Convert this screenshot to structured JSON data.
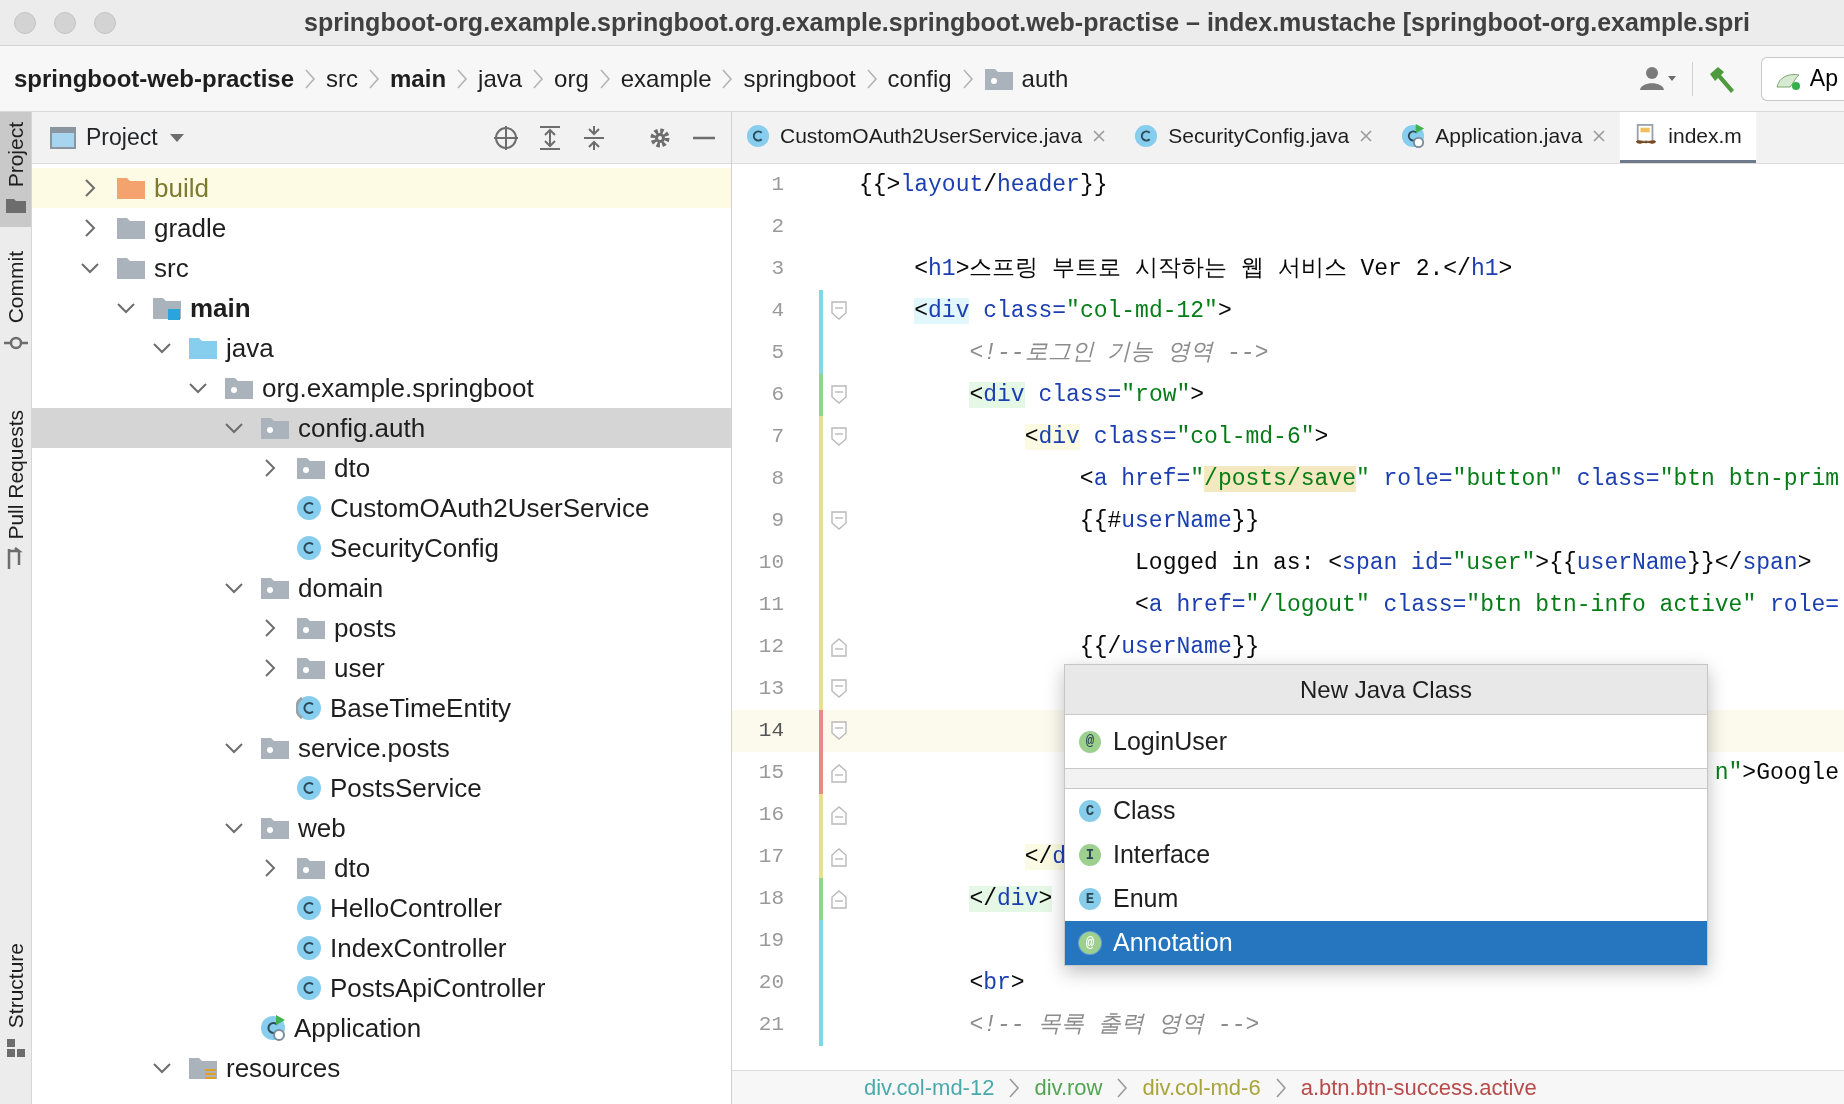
{
  "window": {
    "title": "springboot-org.example.springboot.org.example.springboot.web-practise – index.mustache [springboot-org.example.spri"
  },
  "breadcrumbs": [
    {
      "text": "springboot-web-practise",
      "bold": true,
      "kind": "plain"
    },
    {
      "text": "src",
      "bold": false,
      "kind": "plain"
    },
    {
      "text": "main",
      "bold": true,
      "kind": "plain"
    },
    {
      "text": "java",
      "bold": false,
      "kind": "plain"
    },
    {
      "text": "org",
      "bold": false,
      "kind": "plain"
    },
    {
      "text": "example",
      "bold": false,
      "kind": "plain"
    },
    {
      "text": "springboot",
      "bold": false,
      "kind": "plain"
    },
    {
      "text": "config",
      "bold": false,
      "kind": "plain"
    },
    {
      "text": "auth",
      "bold": false,
      "kind": "package"
    }
  ],
  "toolbar": {
    "run_config": "Ap"
  },
  "tool_strip": [
    {
      "label": "Project",
      "kind": "project",
      "selected": true
    },
    {
      "label": "Commit",
      "kind": "commit",
      "selected": false
    },
    {
      "label": "Pull Requests",
      "kind": "pull-requests",
      "selected": false
    },
    {
      "label": "Structure",
      "kind": "structure",
      "selected": false
    }
  ],
  "project": {
    "title": "Project",
    "tree": [
      {
        "label": "build",
        "kind": "excluded",
        "expanded": false,
        "selected": false
      },
      {
        "label": "gradle",
        "kind": "folder",
        "expanded": false,
        "selected": false
      },
      {
        "label": "src",
        "kind": "folder",
        "expanded": true,
        "selected": false,
        "children": [
          {
            "label": "main",
            "kind": "source-root",
            "expanded": true,
            "selected": false,
            "children": [
              {
                "label": "java",
                "kind": "java-root",
                "expanded": true,
                "selected": false,
                "children": [
                  {
                    "label": "org.example.springboot",
                    "kind": "package",
                    "expanded": true,
                    "selected": false,
                    "children": [
                      {
                        "label": "config.auth",
                        "kind": "package",
                        "expanded": true,
                        "selected": true,
                        "children": [
                          {
                            "label": "dto",
                            "kind": "package",
                            "expanded": false,
                            "selected": false
                          },
                          {
                            "label": "CustomOAuth2UserService",
                            "kind": "class",
                            "selected": false
                          },
                          {
                            "label": "SecurityConfig",
                            "kind": "class",
                            "selected": false
                          }
                        ]
                      },
                      {
                        "label": "domain",
                        "kind": "package",
                        "expanded": true,
                        "selected": false,
                        "children": [
                          {
                            "label": "posts",
                            "kind": "package",
                            "expanded": false,
                            "selected": false
                          },
                          {
                            "label": "user",
                            "kind": "package",
                            "expanded": false,
                            "selected": false
                          },
                          {
                            "label": "BaseTimeEntity",
                            "kind": "abstract-class",
                            "selected": false
                          }
                        ]
                      },
                      {
                        "label": "service.posts",
                        "kind": "package",
                        "expanded": true,
                        "selected": false,
                        "children": [
                          {
                            "label": "PostsService",
                            "kind": "class",
                            "selected": false
                          }
                        ]
                      },
                      {
                        "label": "web",
                        "kind": "package",
                        "expanded": true,
                        "selected": false,
                        "children": [
                          {
                            "label": "dto",
                            "kind": "package",
                            "expanded": false,
                            "selected": false
                          },
                          {
                            "label": "HelloController",
                            "kind": "class",
                            "selected": false
                          },
                          {
                            "label": "IndexController",
                            "kind": "class",
                            "selected": false
                          },
                          {
                            "label": "PostsApiController",
                            "kind": "class",
                            "selected": false
                          }
                        ]
                      },
                      {
                        "label": "Application",
                        "kind": "application",
                        "selected": false
                      }
                    ]
                  }
                ]
              },
              {
                "label": "resources",
                "kind": "resources-root",
                "expanded": true,
                "selected": false
              }
            ]
          }
        ]
      }
    ]
  },
  "tabs": [
    {
      "label": "CustomOAuth2UserService.java",
      "kind": "class",
      "selected": false,
      "closable": true
    },
    {
      "label": "SecurityConfig.java",
      "kind": "class",
      "selected": false,
      "closable": true
    },
    {
      "label": "Application.java",
      "kind": "application",
      "selected": false,
      "closable": true
    },
    {
      "label": "index.m",
      "kind": "mustache",
      "selected": true,
      "closable": false
    }
  ],
  "editor": {
    "lines": [
      {
        "number": "1",
        "kind": "plain",
        "current": false,
        "tokens": [
          {
            "kind": "text",
            "text": "{{>"
          },
          {
            "kind": "mustache",
            "text": "layout"
          },
          {
            "kind": "text",
            "text": "/"
          },
          {
            "kind": "mustache",
            "text": "header"
          },
          {
            "kind": "text",
            "text": "}}"
          }
        ]
      },
      {
        "number": "2",
        "kind": "plain",
        "current": false
      },
      {
        "number": "3",
        "kind": "plain",
        "current": false,
        "tokens": [
          {
            "kind": "text",
            "text": "    <"
          },
          {
            "kind": "tag",
            "text": "h1"
          },
          {
            "kind": "text",
            "text": ">스프링 부트로 시작하는 웹 서비스 Ver 2.</"
          },
          {
            "kind": "tag",
            "text": "h1"
          },
          {
            "kind": "text",
            "text": ">"
          }
        ]
      },
      {
        "number": "4",
        "kind": "fold-start",
        "current": false,
        "color": "#80d8e2",
        "tokens": [
          {
            "kind": "text",
            "text": "    <",
            "color": "#e2f7fb"
          },
          {
            "kind": "tag",
            "text": "div",
            "color": "#e2f7fb"
          },
          {
            "kind": "attr",
            "text": " class="
          },
          {
            "kind": "string",
            "text": "\"col-md-12\""
          },
          {
            "kind": "text",
            "text": ">"
          }
        ]
      },
      {
        "number": "5",
        "kind": "plain",
        "current": false,
        "color": "#80d8e2",
        "tokens": [
          {
            "kind": "comment",
            "text": "        <!--로그인 기능 영역 -->"
          }
        ]
      },
      {
        "number": "6",
        "kind": "fold-start",
        "current": false,
        "color": "#8fd48f",
        "tokens": [
          {
            "kind": "text",
            "text": "        <",
            "color": "#e5f8e5"
          },
          {
            "kind": "tag",
            "text": "div",
            "color": "#e5f8e5"
          },
          {
            "kind": "attr",
            "text": " class="
          },
          {
            "kind": "string",
            "text": "\"row\""
          },
          {
            "kind": "text",
            "text": ">"
          }
        ]
      },
      {
        "number": "7",
        "kind": "fold-start",
        "current": false,
        "color": "#e4e08f",
        "tokens": [
          {
            "kind": "text",
            "text": "            <",
            "color": "#fbfbe3"
          },
          {
            "kind": "tag",
            "text": "div",
            "color": "#fbfbe3"
          },
          {
            "kind": "attr",
            "text": " class="
          },
          {
            "kind": "string",
            "text": "\"col-md-6\""
          },
          {
            "kind": "text",
            "text": ">"
          }
        ]
      },
      {
        "number": "8",
        "kind": "plain",
        "current": false,
        "color": "#e4e08f",
        "tokens": [
          {
            "kind": "text",
            "text": "                <"
          },
          {
            "kind": "tag",
            "text": "a"
          },
          {
            "kind": "attr",
            "text": " href="
          },
          {
            "kind": "string",
            "text": "\""
          },
          {
            "kind": "string",
            "text": "/posts/save",
            "color": "#f4e8c0"
          },
          {
            "kind": "string",
            "text": "\""
          },
          {
            "kind": "attr",
            "text": " role="
          },
          {
            "kind": "string",
            "text": "\"button\""
          },
          {
            "kind": "attr",
            "text": " class="
          },
          {
            "kind": "string",
            "text": "\"btn btn-prim"
          }
        ]
      },
      {
        "number": "9",
        "kind": "fold-start",
        "current": false,
        "color": "#e4e08f",
        "tokens": [
          {
            "kind": "text",
            "text": "                {{#"
          },
          {
            "kind": "mustache",
            "text": "userName"
          },
          {
            "kind": "text",
            "text": "}}"
          }
        ]
      },
      {
        "number": "10",
        "kind": "plain",
        "current": false,
        "color": "#e4e08f",
        "tokens": [
          {
            "kind": "text",
            "text": "                    Logged in as: <"
          },
          {
            "kind": "tag",
            "text": "span"
          },
          {
            "kind": "attr",
            "text": " id="
          },
          {
            "kind": "string",
            "text": "\"user\""
          },
          {
            "kind": "text",
            "text": ">{{"
          },
          {
            "kind": "mustache",
            "text": "userName"
          },
          {
            "kind": "text",
            "text": "}}</"
          },
          {
            "kind": "tag",
            "text": "span"
          },
          {
            "kind": "text",
            "text": ">"
          }
        ]
      },
      {
        "number": "11",
        "kind": "plain",
        "current": false,
        "color": "#e4e08f",
        "tokens": [
          {
            "kind": "text",
            "text": "                    <"
          },
          {
            "kind": "tag",
            "text": "a"
          },
          {
            "kind": "attr",
            "text": " href="
          },
          {
            "kind": "string",
            "text": "\"/logout\""
          },
          {
            "kind": "attr",
            "text": " class="
          },
          {
            "kind": "string",
            "text": "\"btn btn-info active\""
          },
          {
            "kind": "attr",
            "text": " role="
          }
        ]
      },
      {
        "number": "12",
        "kind": "fold-end",
        "current": false,
        "color": "#e4e08f",
        "tokens": [
          {
            "kind": "text",
            "text": "                {{/"
          },
          {
            "kind": "mustache",
            "text": "userName"
          },
          {
            "kind": "text",
            "text": "}}"
          }
        ]
      },
      {
        "number": "13",
        "kind": "fold-start",
        "current": false,
        "color": "#e4e08f"
      },
      {
        "number": "14",
        "kind": "fold-start",
        "current": true,
        "color": "#e88a8a"
      },
      {
        "number": "15",
        "kind": "fold-end",
        "current": false,
        "color": "#e88a8a",
        "tokens": [
          {
            "kind": "string",
            "text": "                                                              n\""
          },
          {
            "kind": "text",
            "text": ">Google"
          }
        ]
      },
      {
        "number": "16",
        "kind": "fold-end",
        "current": false,
        "color": "#e4e08f"
      },
      {
        "number": "17",
        "kind": "fold-end",
        "current": false,
        "color": "#e4e08f",
        "tokens": [
          {
            "kind": "text",
            "text": "            </",
            "color": "#fbfbe3"
          },
          {
            "kind": "tag",
            "text": "d",
            "color": "#fbfbe3"
          }
        ]
      },
      {
        "number": "18",
        "kind": "fold-end",
        "current": false,
        "color": "#8fd48f",
        "tokens": [
          {
            "kind": "text",
            "text": "        </",
            "color": "#e5f8e5"
          },
          {
            "kind": "tag",
            "text": "div",
            "color": "#e5f8e5"
          },
          {
            "kind": "text",
            "text": ">",
            "color": "#e5f8e5"
          }
        ]
      },
      {
        "number": "19",
        "kind": "plain",
        "current": false,
        "color": "#80d8e2"
      },
      {
        "number": "20",
        "kind": "plain",
        "current": false,
        "color": "#80d8e2",
        "tokens": [
          {
            "kind": "text",
            "text": "        <"
          },
          {
            "kind": "tag",
            "text": "br"
          },
          {
            "kind": "text",
            "text": ">"
          }
        ]
      },
      {
        "number": "21",
        "kind": "plain",
        "current": false,
        "color": "#80d8e2",
        "tokens": [
          {
            "kind": "comment",
            "text": "        <!-- 목록 출력 영역 -->"
          }
        ]
      }
    ]
  },
  "popup": {
    "title": "New Java Class",
    "field": {
      "value": "LoginUser",
      "badge": "@",
      "color": "#9dd08e"
    },
    "items": [
      {
        "label": "Class",
        "badge": "C",
        "color": "#87cde9",
        "selected": false
      },
      {
        "label": "Interface",
        "badge": "I",
        "color": "#9dd08e",
        "selected": false
      },
      {
        "label": "Enum",
        "badge": "E",
        "color": "#87cde9",
        "selected": false
      },
      {
        "label": "Annotation",
        "badge": "@",
        "color": "#9dd08e",
        "selected": true
      }
    ]
  },
  "status_path": [
    {
      "text": "div.col-md-12",
      "color": "#4aa9ab"
    },
    {
      "text": "div.row",
      "color": "#52a352"
    },
    {
      "text": "div.col-md-6",
      "color": "#a8a43a"
    },
    {
      "text": "a.btn.btn-success.active",
      "color": "#b84a4a"
    }
  ]
}
